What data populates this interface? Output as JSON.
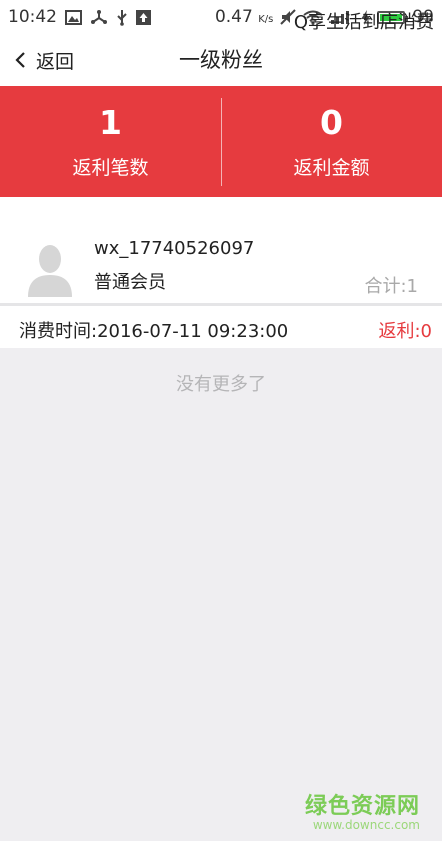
{
  "statusbar": {
    "time": "10:42",
    "speed": "0.47",
    "speed_unit": "K/s",
    "battery": "99",
    "battery_color": "#2ecc40"
  },
  "nav": {
    "back_label": "返回",
    "title": "一级粉丝"
  },
  "stats": {
    "count_value": "1",
    "count_label": "返利笔数",
    "amount_value": "0",
    "amount_label": "返利金额",
    "bg_color": "#e63b3f"
  },
  "member": {
    "merchant": "Q享生活到店消费",
    "username": "wx_17740526097",
    "level": "普通会员",
    "total": "合计:1"
  },
  "record": {
    "time": "消费时间:2016-07-11 09:23:00",
    "rebate": "返利:0"
  },
  "footer": {
    "no_more": "没有更多了"
  },
  "watermark": {
    "brand": "绿色资源网",
    "url": "www.downcc.com"
  }
}
